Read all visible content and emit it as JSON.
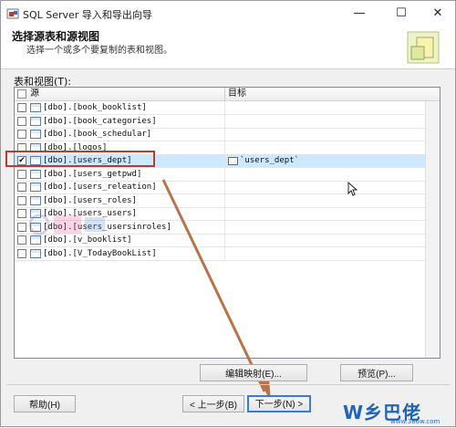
{
  "window": {
    "title": "SQL Server 导入和导出向导",
    "controls": [
      "—",
      "☐",
      "✕"
    ]
  },
  "banner": {
    "title": "选择源表和源视图",
    "subtitle": "选择一个或多个要复制的表和视图。"
  },
  "grid": {
    "section_label": "表和视图(T):",
    "headers": {
      "source": "源",
      "target": "目标"
    },
    "rows": [
      {
        "source": "[dbo].[book_booklist]",
        "checked": false,
        "target": ""
      },
      {
        "source": "[dbo].[book_categories]",
        "checked": false,
        "target": ""
      },
      {
        "source": "[dbo].[book_schedular]",
        "checked": false,
        "target": ""
      },
      {
        "source": "[dbo].[logos]",
        "checked": false,
        "target": ""
      },
      {
        "source": "[dbo].[users_dept]",
        "checked": true,
        "target": "`users_dept`",
        "selected": true
      },
      {
        "source": "[dbo].[users_getpwd]",
        "checked": false,
        "target": ""
      },
      {
        "source": "[dbo].[users_releation]",
        "checked": false,
        "target": ""
      },
      {
        "source": "[dbo].[users_roles]",
        "checked": false,
        "target": ""
      },
      {
        "source": "[dbo].[users_users]",
        "checked": false,
        "target": ""
      },
      {
        "source": "[dbo].[users_usersinroles]",
        "checked": false,
        "target": ""
      },
      {
        "source": "[dbo].[v_booklist]",
        "checked": false,
        "target": ""
      },
      {
        "source": "[dbo].[V_TodayBookList]",
        "checked": false,
        "target": ""
      }
    ]
  },
  "buttons": {
    "edit_mapping": "编辑映射(E)...",
    "preview": "预览(P)...",
    "help": "帮助(H)",
    "back": "< 上一步(B)",
    "next": "下一步(N) >"
  },
  "watermark": {
    "text": "W乡巴佬",
    "url": "www.386w.com",
    "faint": "386w"
  },
  "colors": {
    "highlight": "#c0392b",
    "arrow": "#b8734a",
    "selection": "#cde8ff"
  }
}
